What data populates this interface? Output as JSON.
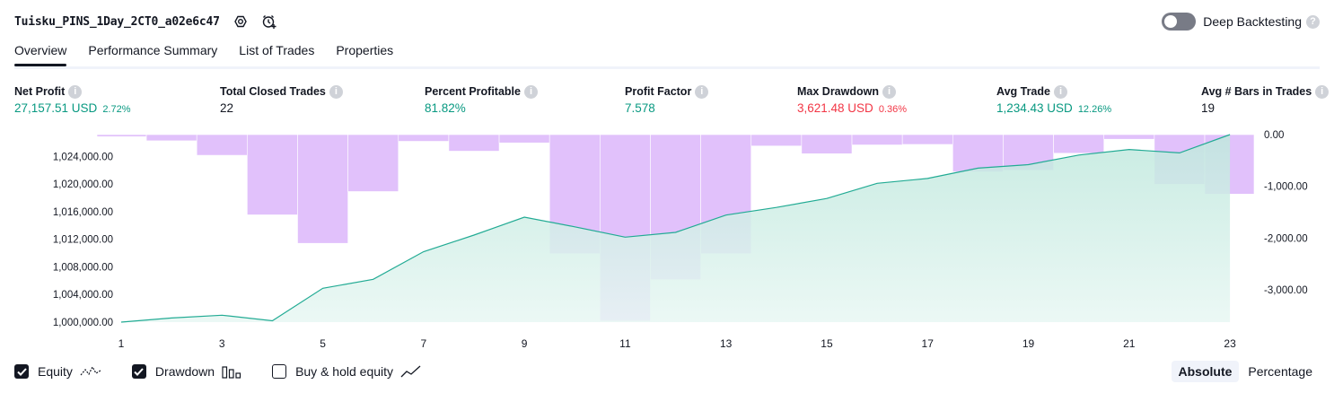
{
  "header": {
    "title": "Tuisku_PINS_1Day_2CT0_a02e6c47",
    "deep_backtesting_label": "Deep Backtesting",
    "deep_backtesting_enabled": false
  },
  "tabs": [
    {
      "label": "Overview",
      "active": true
    },
    {
      "label": "Performance Summary",
      "active": false
    },
    {
      "label": "List of Trades",
      "active": false
    },
    {
      "label": "Properties",
      "active": false
    }
  ],
  "stats": {
    "net_profit": {
      "label": "Net Profit",
      "value": "27,157.51 USD",
      "pct": "2.72%"
    },
    "total_closed_trades": {
      "label": "Total Closed Trades",
      "value": "22"
    },
    "percent_profitable": {
      "label": "Percent Profitable",
      "value": "81.82%"
    },
    "profit_factor": {
      "label": "Profit Factor",
      "value": "7.578"
    },
    "max_drawdown": {
      "label": "Max Drawdown",
      "value": "3,621.48 USD",
      "pct": "0.36%"
    },
    "avg_trade": {
      "label": "Avg Trade",
      "value": "1,234.43 USD",
      "pct": "12.26%"
    },
    "avg_bars": {
      "label": "Avg # Bars in Trades",
      "value": "19"
    }
  },
  "chart_data": {
    "type": "area",
    "x": [
      1,
      2,
      3,
      4,
      5,
      6,
      7,
      8,
      9,
      10,
      11,
      12,
      13,
      14,
      15,
      16,
      17,
      18,
      19,
      20,
      21,
      22,
      23
    ],
    "x_ticks": [
      "1",
      "3",
      "5",
      "7",
      "9",
      "11",
      "13",
      "15",
      "17",
      "19",
      "21",
      "23"
    ],
    "series": [
      {
        "name": "Equity",
        "axis": "left",
        "values": [
          1000000,
          1000600,
          1001000,
          1000200,
          1004900,
          1006200,
          1010200,
          1012600,
          1015200,
          1013800,
          1012300,
          1013000,
          1015500,
          1016600,
          1017900,
          1020100,
          1020800,
          1022300,
          1022800,
          1024200,
          1025000,
          1024500,
          1027157
        ]
      },
      {
        "name": "Drawdown",
        "axis": "right",
        "values": [
          -40,
          -120,
          -400,
          -1550,
          -2100,
          -1100,
          -130,
          -320,
          -160,
          -2300,
          -3600,
          -2800,
          -2300,
          -220,
          -370,
          -200,
          -190,
          -720,
          -690,
          -360,
          -90,
          -960,
          -1150
        ]
      }
    ],
    "left_axis": {
      "min": 1000000,
      "max": 1027157,
      "ticks": [
        "1,000,000.00",
        "1,004,000.00",
        "1,008,000.00",
        "1,012,000.00",
        "1,016,000.00",
        "1,020,000.00",
        "1,024,000.00"
      ],
      "tick_values": [
        1000000,
        1004000,
        1008000,
        1012000,
        1016000,
        1020000,
        1024000
      ]
    },
    "right_axis": {
      "min": -3621.48,
      "max": 0,
      "ticks": [
        "0.00",
        "-1,000.00",
        "-2,000.00",
        "-3,000.00"
      ],
      "tick_values": [
        0,
        -1000,
        -2000,
        -3000
      ]
    },
    "colors": {
      "equity_line": "#22ab94",
      "equity_fill_top": "#bfe8dd",
      "equity_fill_bottom": "#e8f7f3",
      "drawdown": "#e1c1fb"
    }
  },
  "legend": {
    "equity": {
      "label": "Equity",
      "checked": true
    },
    "drawdown": {
      "label": "Drawdown",
      "checked": true
    },
    "buy_hold": {
      "label": "Buy & hold equity",
      "checked": false
    }
  },
  "mode": {
    "absolute_label": "Absolute",
    "percentage_label": "Percentage",
    "selected": "Absolute"
  }
}
